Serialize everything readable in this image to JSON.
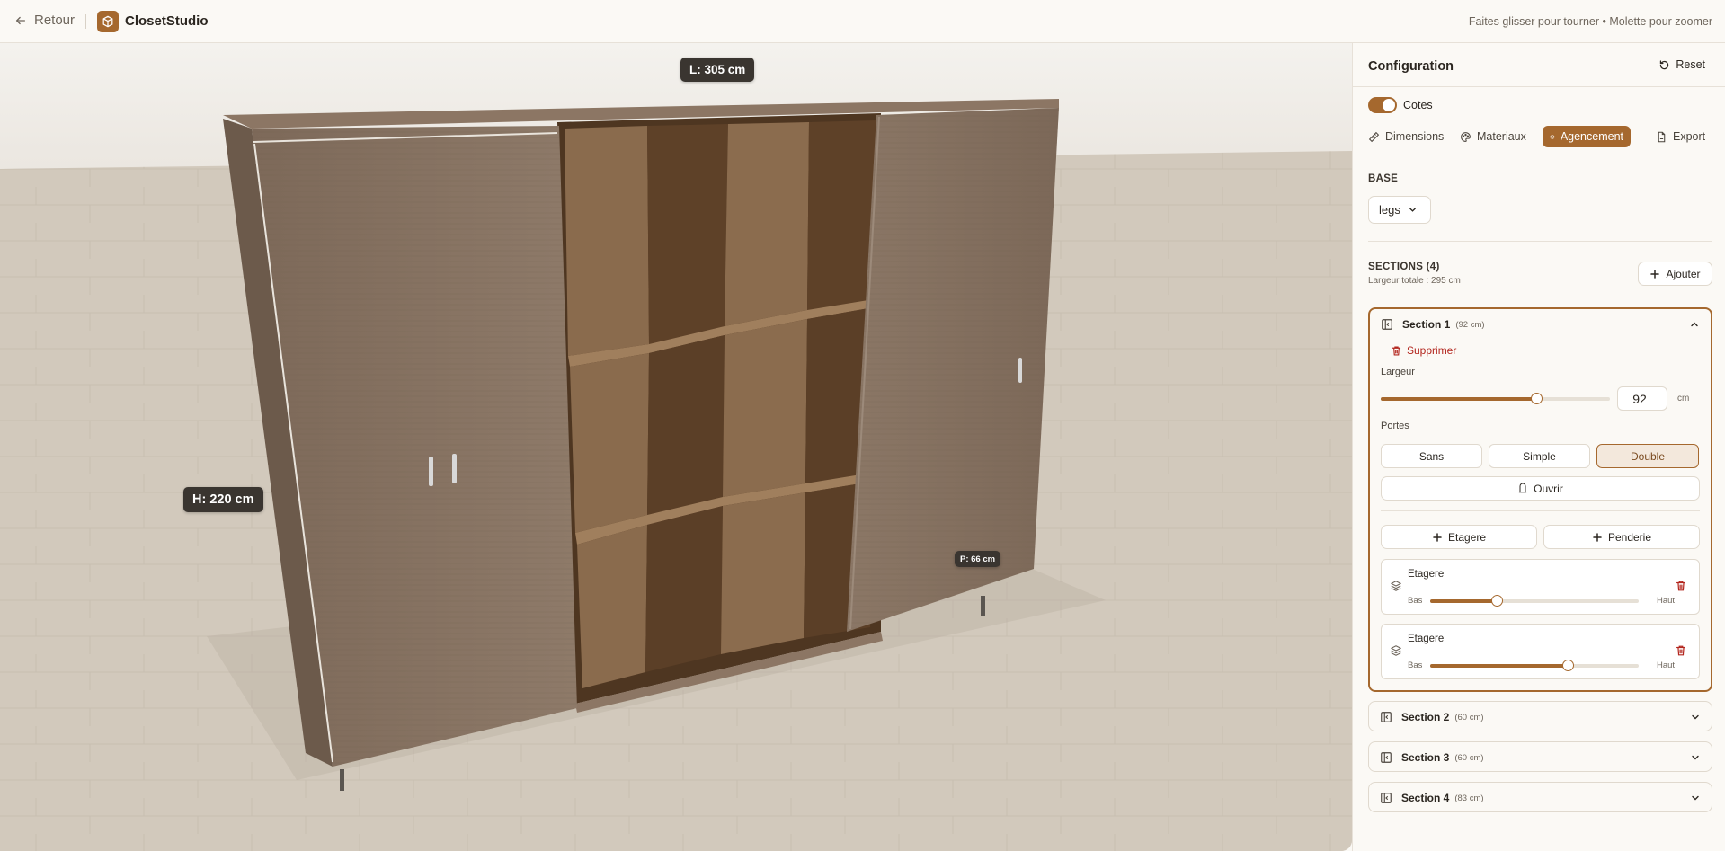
{
  "header": {
    "back_label": "Retour",
    "brand": "ClosetStudio",
    "hint": "Faites glisser pour tourner • Molette pour zoomer"
  },
  "viewport": {
    "width_label": "L: 305 cm",
    "height_label": "H: 220 cm",
    "depth_label": "P: 66 cm"
  },
  "sidebar": {
    "title": "Configuration",
    "reset_label": "Reset",
    "toggle_label": "Cotes",
    "toggle_on": true,
    "tabs": [
      {
        "label": "Dimensions",
        "icon": "ruler-icon"
      },
      {
        "label": "Materiaux",
        "icon": "palette-icon"
      },
      {
        "label": "Agencement",
        "icon": "layers-icon",
        "active": true
      },
      {
        "label": "Export",
        "icon": "file-icon"
      }
    ],
    "base": {
      "label": "BASE",
      "value": "legs"
    },
    "sections_header": {
      "title": "SECTIONS (4)",
      "total": "Largeur totale : 295 cm",
      "add_label": "Ajouter"
    },
    "section1": {
      "name": "Section 1",
      "size": "(92 cm)",
      "delete_label": "Supprimer",
      "width_label": "Largeur",
      "width_value": "92",
      "width_fraction": 0.68,
      "unit": "cm",
      "doors_label": "Portes",
      "door_options": [
        "Sans",
        "Simple",
        "Double"
      ],
      "door_selected": "Double",
      "open_label": "Ouvrir",
      "add_shelf_label": "Etagere",
      "add_rod_label": "Penderie",
      "items": [
        {
          "title": "Etagere",
          "low": "Bas",
          "high": "Haut",
          "position": 0.32
        },
        {
          "title": "Etagere",
          "low": "Bas",
          "high": "Haut",
          "position": 0.66
        }
      ]
    },
    "collapsed_sections": [
      {
        "name": "Section 2",
        "size": "(60 cm)"
      },
      {
        "name": "Section 3",
        "size": "(60 cm)"
      },
      {
        "name": "Section 4",
        "size": "(83 cm)"
      }
    ]
  },
  "colors": {
    "accent": "#a5682e",
    "danger": "#b3261e",
    "background": "#fbf9f5"
  }
}
